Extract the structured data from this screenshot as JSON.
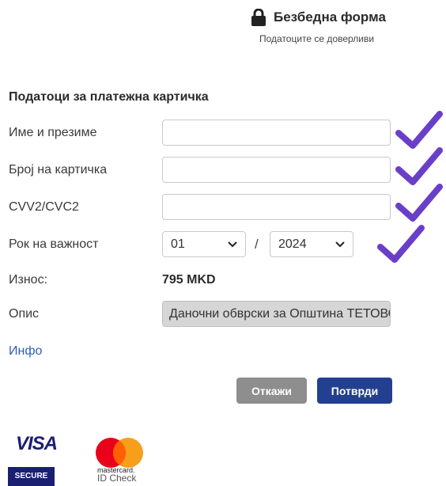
{
  "header": {
    "secure_title": "Безбедна форма",
    "secure_subtitle": "Податоците се доверливи",
    "lock_icon": "lock-icon"
  },
  "form": {
    "section_title": "Податоци за платежна картичка",
    "name_label": "Име и презиме",
    "name_value": "",
    "card_label": "Број на картичка",
    "card_value": "",
    "cvv_label": "CVV2/CVC2",
    "cvv_value": "",
    "expiry_label": "Рок на важност",
    "expiry_month": "01",
    "expiry_separator": "/",
    "expiry_year": "2024",
    "amount_label": "Износ:",
    "amount_value": "795 MKD",
    "description_label": "Опис",
    "description_value": "Даночни обврски за Општина ТЕТОВО",
    "info_link": "Инфо"
  },
  "actions": {
    "cancel_label": "Откажи",
    "confirm_label": "Потврди"
  },
  "logos": {
    "visa_word": "VISA",
    "visa_secure": "SECURE",
    "mastercard_word": "mastercard.",
    "mastercard_sub": "ID Check"
  },
  "colors": {
    "confirm_button": "#233f8f",
    "cancel_button": "#8e8e8e",
    "link": "#2f5fb3",
    "checkmark": "#6a3fc8"
  }
}
